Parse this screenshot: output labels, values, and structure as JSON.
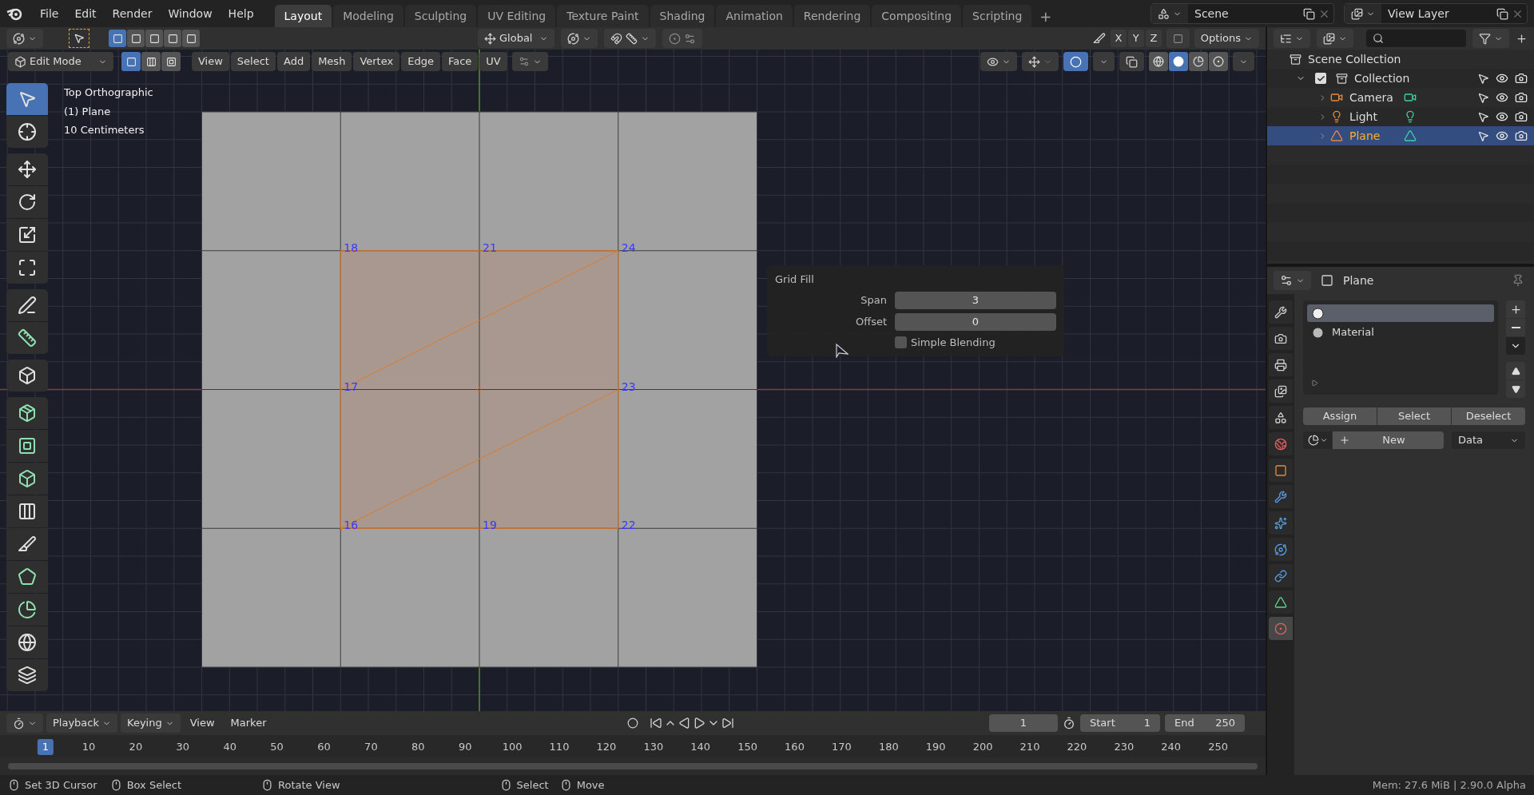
{
  "menu": [
    "File",
    "Edit",
    "Render",
    "Window",
    "Help"
  ],
  "workspace_tabs": [
    {
      "label": "Layout",
      "selected": true
    },
    {
      "label": "Modeling",
      "selected": false
    },
    {
      "label": "Sculpting",
      "selected": false
    },
    {
      "label": "UV Editing",
      "selected": false
    },
    {
      "label": "Texture Paint",
      "selected": false
    },
    {
      "label": "Shading",
      "selected": false
    },
    {
      "label": "Animation",
      "selected": false
    },
    {
      "label": "Rendering",
      "selected": false
    },
    {
      "label": "Compositing",
      "selected": false
    },
    {
      "label": "Scripting",
      "selected": false
    }
  ],
  "add_tab": "+",
  "scene": "Scene",
  "view_layer": "View Layer",
  "tool_header": {
    "orientation": "Global",
    "axes": [
      "X",
      "Y",
      "Z"
    ],
    "options": "Options"
  },
  "viewport_header": {
    "mode": "Edit Mode",
    "select_modes": [
      {
        "kind": "vertex",
        "selected": true
      },
      {
        "kind": "edge",
        "selected": false
      },
      {
        "kind": "face",
        "selected": false
      }
    ],
    "menus": [
      "View",
      "Select",
      "Add",
      "Mesh",
      "Vertex",
      "Edge",
      "Face",
      "UV"
    ],
    "shading_modes": [
      {
        "kind": "wireframe",
        "selected": false
      },
      {
        "kind": "solid",
        "selected": true
      },
      {
        "kind": "material",
        "selected": false
      },
      {
        "kind": "rendered",
        "selected": false
      }
    ]
  },
  "toolbar_groups": [
    {
      "tools": [
        {
          "kind": "select",
          "selected": true
        },
        {
          "kind": "cursor",
          "selected": false
        }
      ]
    },
    {
      "tools": [
        {
          "kind": "move",
          "selected": false
        },
        {
          "kind": "rotate",
          "selected": false
        },
        {
          "kind": "scale",
          "selected": false
        },
        {
          "kind": "transform",
          "selected": false
        }
      ]
    },
    {
      "tools": [
        {
          "kind": "annotate",
          "selected": false
        },
        {
          "kind": "measure",
          "selected": false
        }
      ]
    },
    {
      "tools": [
        {
          "kind": "add_cube",
          "selected": false
        }
      ]
    },
    {
      "tools": [
        {
          "kind": "extrude",
          "selected": false
        },
        {
          "kind": "inset",
          "selected": false
        },
        {
          "kind": "bevel",
          "selected": false
        },
        {
          "kind": "loop_cut",
          "selected": false
        },
        {
          "kind": "knife",
          "selected": false
        },
        {
          "kind": "poly_build",
          "selected": false
        },
        {
          "kind": "spin",
          "selected": false
        },
        {
          "kind": "smooth",
          "selected": false
        },
        {
          "kind": "shear",
          "selected": false
        }
      ]
    }
  ],
  "viewport_info": [
    "Top Orthographic",
    "(1) Plane",
    "10 Centimeters"
  ],
  "vertex_labels": [
    "18",
    "21",
    "24",
    "17",
    "23",
    "16",
    "19",
    "22"
  ],
  "operator_panel": {
    "title": "Grid Fill",
    "fields": [
      {
        "label": "Span",
        "value": "3"
      },
      {
        "label": "Offset",
        "value": "0"
      }
    ],
    "checkbox": {
      "label": "Simple Blending",
      "checked": false
    }
  },
  "outliner": {
    "root": "Scene Collection",
    "items": [
      {
        "label": "Collection",
        "kind": "collection",
        "checked": true,
        "expanded": true,
        "children": [
          {
            "label": "Camera",
            "kind": "camera",
            "selected": false
          },
          {
            "label": "Light",
            "kind": "light",
            "selected": false
          },
          {
            "label": "Plane",
            "kind": "mesh",
            "selected": true
          }
        ]
      }
    ]
  },
  "properties": {
    "object": "Plane",
    "tabs": [
      {
        "kind": "tool",
        "selected": false
      },
      {
        "kind": "render",
        "selected": false
      },
      {
        "kind": "output",
        "selected": false
      },
      {
        "kind": "view_layer",
        "selected": false
      },
      {
        "kind": "scene",
        "selected": false
      },
      {
        "kind": "world",
        "selected": false
      },
      {
        "kind": "object",
        "selected": false
      },
      {
        "kind": "modifiers",
        "selected": false
      },
      {
        "kind": "particles",
        "selected": false
      },
      {
        "kind": "physics",
        "selected": false
      },
      {
        "kind": "constraints",
        "selected": false
      },
      {
        "kind": "data",
        "selected": false
      },
      {
        "kind": "material",
        "selected": true
      }
    ],
    "material_slots": [
      {
        "selected": true
      },
      {
        "label": "Material",
        "selected": false
      }
    ],
    "buttons": [
      "Assign",
      "Select",
      "Deselect"
    ],
    "new_button": "New",
    "link": "Data"
  },
  "timeline": {
    "menus": [
      "Playback",
      "Keying",
      "View",
      "Marker"
    ],
    "current_frame": "1",
    "start_label": "Start",
    "start": "1",
    "end_label": "End",
    "end": "250",
    "ruler": [
      {
        "label": "1",
        "selected": true
      },
      {
        "label": "10",
        "selected": false
      },
      {
        "label": "20",
        "selected": false
      },
      {
        "label": "30",
        "selected": false
      },
      {
        "label": "40",
        "selected": false
      },
      {
        "label": "50",
        "selected": false
      },
      {
        "label": "60",
        "selected": false
      },
      {
        "label": "70",
        "selected": false
      },
      {
        "label": "80",
        "selected": false
      },
      {
        "label": "90",
        "selected": false
      },
      {
        "label": "100",
        "selected": false
      },
      {
        "label": "110",
        "selected": false
      },
      {
        "label": "120",
        "selected": false
      },
      {
        "label": "130",
        "selected": false
      },
      {
        "label": "140",
        "selected": false
      },
      {
        "label": "150",
        "selected": false
      },
      {
        "label": "160",
        "selected": false
      },
      {
        "label": "170",
        "selected": false
      },
      {
        "label": "180",
        "selected": false
      },
      {
        "label": "190",
        "selected": false
      },
      {
        "label": "200",
        "selected": false
      },
      {
        "label": "210",
        "selected": false
      },
      {
        "label": "220",
        "selected": false
      },
      {
        "label": "230",
        "selected": false
      },
      {
        "label": "240",
        "selected": false
      },
      {
        "label": "250",
        "selected": false
      }
    ]
  },
  "status_bar": {
    "hints": [
      "Set 3D Cursor",
      "Box Select",
      "Rotate View",
      "Select",
      "Move"
    ],
    "memory": "Mem: 27.6 MiB | 2.90.0 Alpha"
  }
}
